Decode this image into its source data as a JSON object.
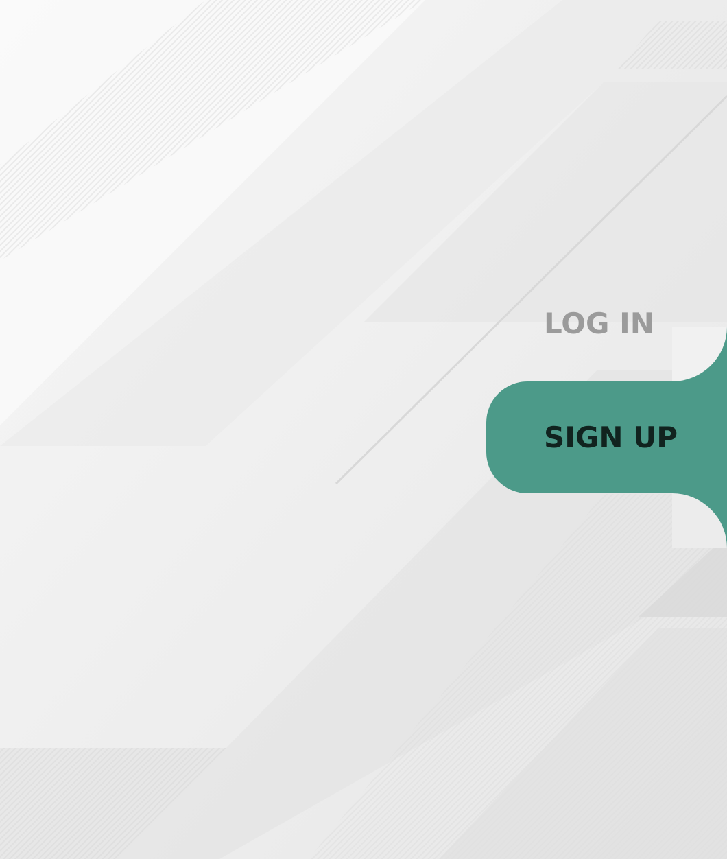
{
  "colors": {
    "accent": "#4c9a89",
    "inactive_text": "#9b9b9b",
    "active_text": "#11231f",
    "background": "#f1f1f1"
  },
  "nav": {
    "items": [
      {
        "label": "LOG IN",
        "active": false
      },
      {
        "label": "SIGN UP",
        "active": true
      }
    ]
  }
}
